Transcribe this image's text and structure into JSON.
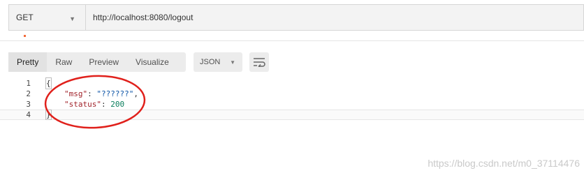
{
  "request": {
    "method": "GET",
    "url": "http://localhost:8080/logout"
  },
  "response": {
    "view_tabs": [
      "Pretty",
      "Raw",
      "Preview",
      "Visualize"
    ],
    "active_tab": "Pretty",
    "format": "JSON",
    "wrap_icon": "wrap-lines-icon",
    "lines": [
      {
        "num": "1",
        "text": "{"
      },
      {
        "num": "2",
        "key": "\"msg\"",
        "sep": ": ",
        "value": "\"??????\"",
        "tail": ","
      },
      {
        "num": "3",
        "key": "\"status\"",
        "sep": ": ",
        "value": "200",
        "tail": ""
      },
      {
        "num": "4",
        "text": "}"
      }
    ]
  },
  "colors": {
    "accent": "#f26b3a",
    "annotation": "#e0201b",
    "json_key": "#a1232b",
    "json_string": "#0b53a6",
    "json_number": "#0a7e5c"
  },
  "watermark": "https://blog.csdn.net/m0_37114476"
}
